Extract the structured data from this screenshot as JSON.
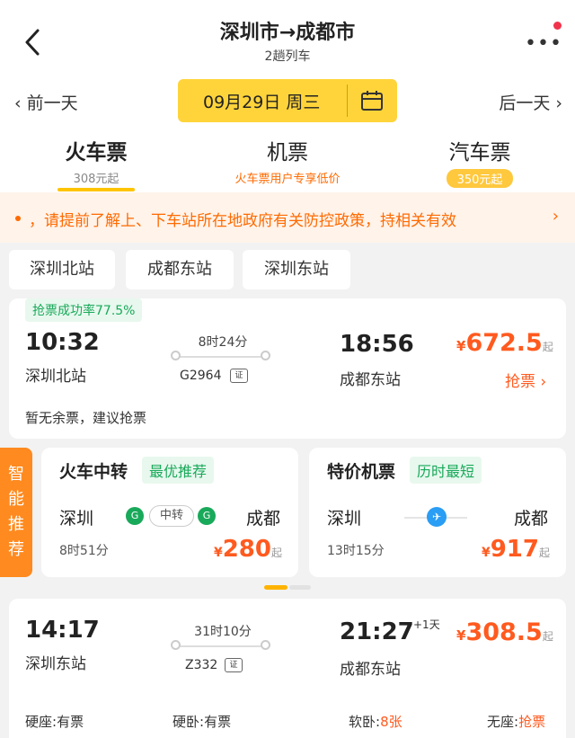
{
  "header": {
    "title": "深圳市→成都市",
    "subtitle": "2趟列车"
  },
  "date_bar": {
    "prev_label": "前一天",
    "date_label": "09月29日 周三",
    "next_label": "后一天"
  },
  "modes": [
    {
      "label": "火车票",
      "sub": "308元起",
      "active": true
    },
    {
      "label": "机票",
      "sub": "火车票用户专享低价",
      "active": false
    },
    {
      "label": "汽车票",
      "sub": "350元起",
      "active": false
    }
  ],
  "notice": {
    "text": "，请提前了解上、下车站所在地政府有关防控政策，持相关有效"
  },
  "filters": [
    "深圳北站",
    "成都东站",
    "深圳东站"
  ],
  "trains": [
    {
      "success_rate": "抢票成功率77.5%",
      "depart_time": "10:32",
      "depart_station": "深圳北站",
      "duration": "8时24分",
      "train_no": "G2964",
      "arrive_time": "18:56",
      "arrive_station": "成都东站",
      "price_currency": "¥",
      "price": "672.5",
      "price_suffix": "起",
      "action": "抢票 ›",
      "note": "暂无余票，建议抢票"
    },
    {
      "depart_time": "14:17",
      "depart_station": "深圳东站",
      "duration": "31时10分",
      "train_no": "Z332",
      "arrive_time": "21:27",
      "arrive_day_offset": "+1天",
      "arrive_station": "成都东站",
      "price_currency": "¥",
      "price": "308.5",
      "price_suffix": "起",
      "seats": [
        {
          "type": "硬座:",
          "status": "有票"
        },
        {
          "type": "硬卧:",
          "status": "有票"
        },
        {
          "type": "软卧:",
          "status": "8张"
        },
        {
          "type": "无座:",
          "status": "抢票"
        }
      ]
    }
  ],
  "smart_recommend": {
    "label": "智能推荐",
    "cards": [
      {
        "title": "火车中转",
        "badge": "最优推荐",
        "from": "深圳",
        "to": "成都",
        "middle": "中转",
        "duration": "8时51分",
        "currency": "¥",
        "price": "280",
        "suffix": "起"
      },
      {
        "title": "特价机票",
        "badge": "历时最短",
        "from": "深圳",
        "to": "成都",
        "duration": "13时15分",
        "currency": "¥",
        "price": "917",
        "suffix": "起"
      }
    ]
  },
  "colors": {
    "accent_yellow": "#ffd43b",
    "price_orange": "#ff5a1f",
    "success_green": "#19a95a",
    "notice_bg": "#fff3ea"
  }
}
